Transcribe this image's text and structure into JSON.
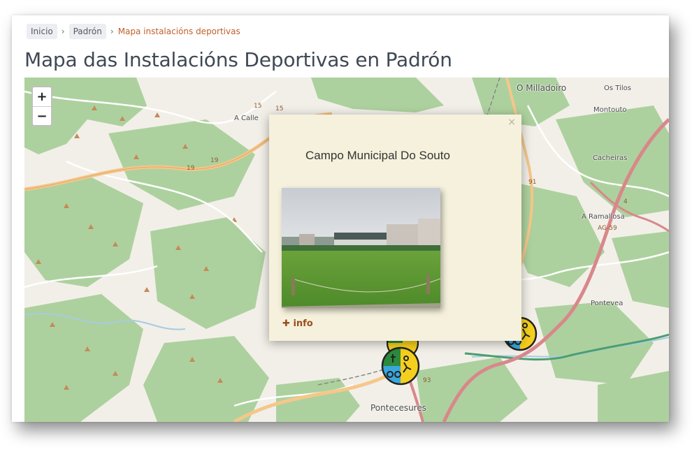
{
  "breadcrumb": {
    "items": [
      "Inicio",
      "Padrón"
    ],
    "current": "Mapa instalacións deportivas",
    "separator": "›"
  },
  "page": {
    "title": "Mapa das Instalacións Deportivas en Padrón"
  },
  "map": {
    "zoom_in": "+",
    "zoom_out": "−",
    "places": [
      "O Milladoiro",
      "Os Tilos",
      "Montouto",
      "Cacheiras",
      "A Ramallosa",
      "Pontevea",
      "Pontecesures",
      "A Calle"
    ],
    "road_labels": [
      "15",
      "15",
      "19",
      "19",
      "AG-59",
      "91",
      "4",
      "93"
    ],
    "colors": {
      "land": "#f2efe9",
      "forest": "#add19e",
      "road_major": "#f5c78a",
      "road_red": "#d9878a",
      "water": "#a7cce0"
    },
    "markers": [
      {
        "icon": "sports-facility-marker-icon",
        "colors": [
          "#f5cf1d",
          "#3aa6dd",
          "#2c8a3c"
        ]
      },
      {
        "icon": "sports-facility-marker-icon",
        "colors": [
          "#f5cf1d",
          "#3aa6dd",
          "#2c8a3c"
        ]
      },
      {
        "icon": "sports-facility-marker-icon",
        "colors": [
          "#f5cf1d",
          "#3aa6dd"
        ]
      }
    ]
  },
  "popup": {
    "title": "Campo Municipal Do Souto",
    "close": "×",
    "info_link": "info",
    "info_icon": "plus-icon",
    "bg_color": "#f5f1dc"
  }
}
